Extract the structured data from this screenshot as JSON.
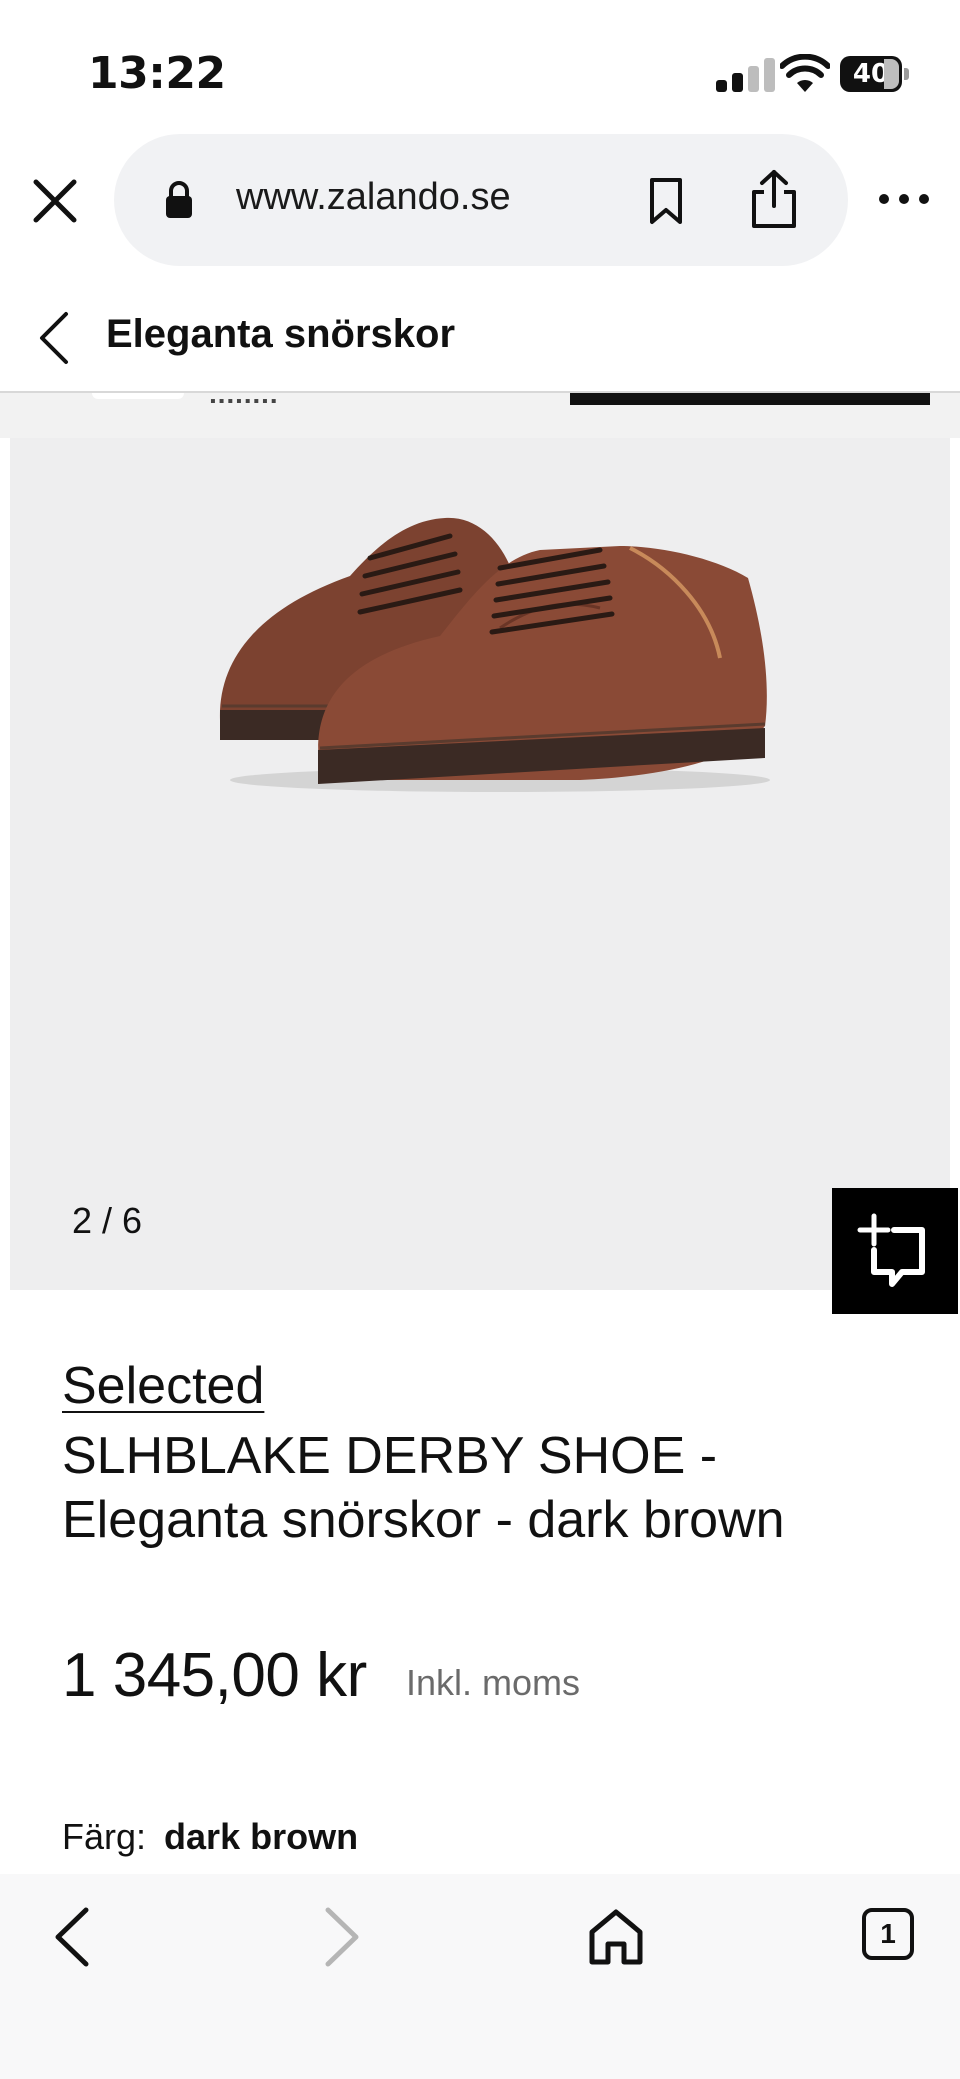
{
  "status": {
    "time": "13:22",
    "battery": "40"
  },
  "browser": {
    "url": "www.zalando.se"
  },
  "header": {
    "title": "Eleganta snörskor"
  },
  "gallery": {
    "counter": "2 / 6"
  },
  "product": {
    "brand": "Selected",
    "title": "SLHBLAKE DERBY SHOE - Eleganta snörskor - dark brown",
    "price": "1 345,00 kr",
    "vat_note": "Inkl. moms",
    "color_label": "Färg:",
    "color_value": "dark brown"
  },
  "toolbar": {
    "tab_count": "1"
  },
  "colors": {
    "shoe": "#8a4a36",
    "sole": "#3b2a24",
    "accent": "#000000"
  }
}
